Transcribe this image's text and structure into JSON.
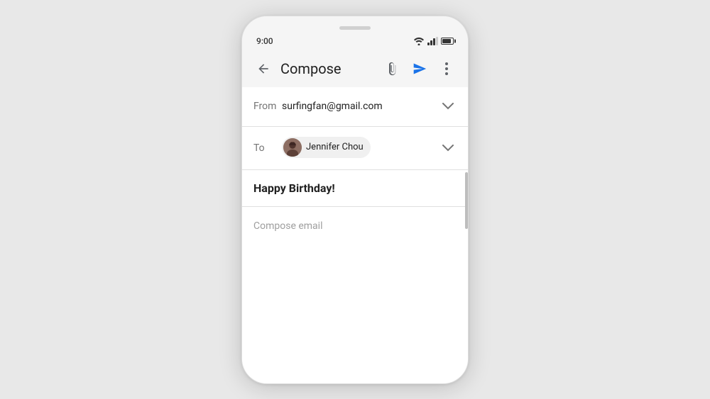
{
  "status_bar": {
    "time": "9:00",
    "wifi_label": "wifi",
    "signal_label": "signal",
    "battery_label": "battery"
  },
  "toolbar": {
    "back_label": "back",
    "title": "Compose",
    "attach_label": "attach",
    "send_label": "send",
    "more_label": "more options"
  },
  "compose": {
    "from_label": "From",
    "from_value": "surfingfan@gmail.com",
    "to_label": "To",
    "to_contact": "Jennifer Chou",
    "subject": "Happy Birthday!",
    "body_placeholder": "Compose email"
  },
  "colors": {
    "send_icon": "#1A73E8",
    "toolbar_icon": "#5f6368"
  }
}
